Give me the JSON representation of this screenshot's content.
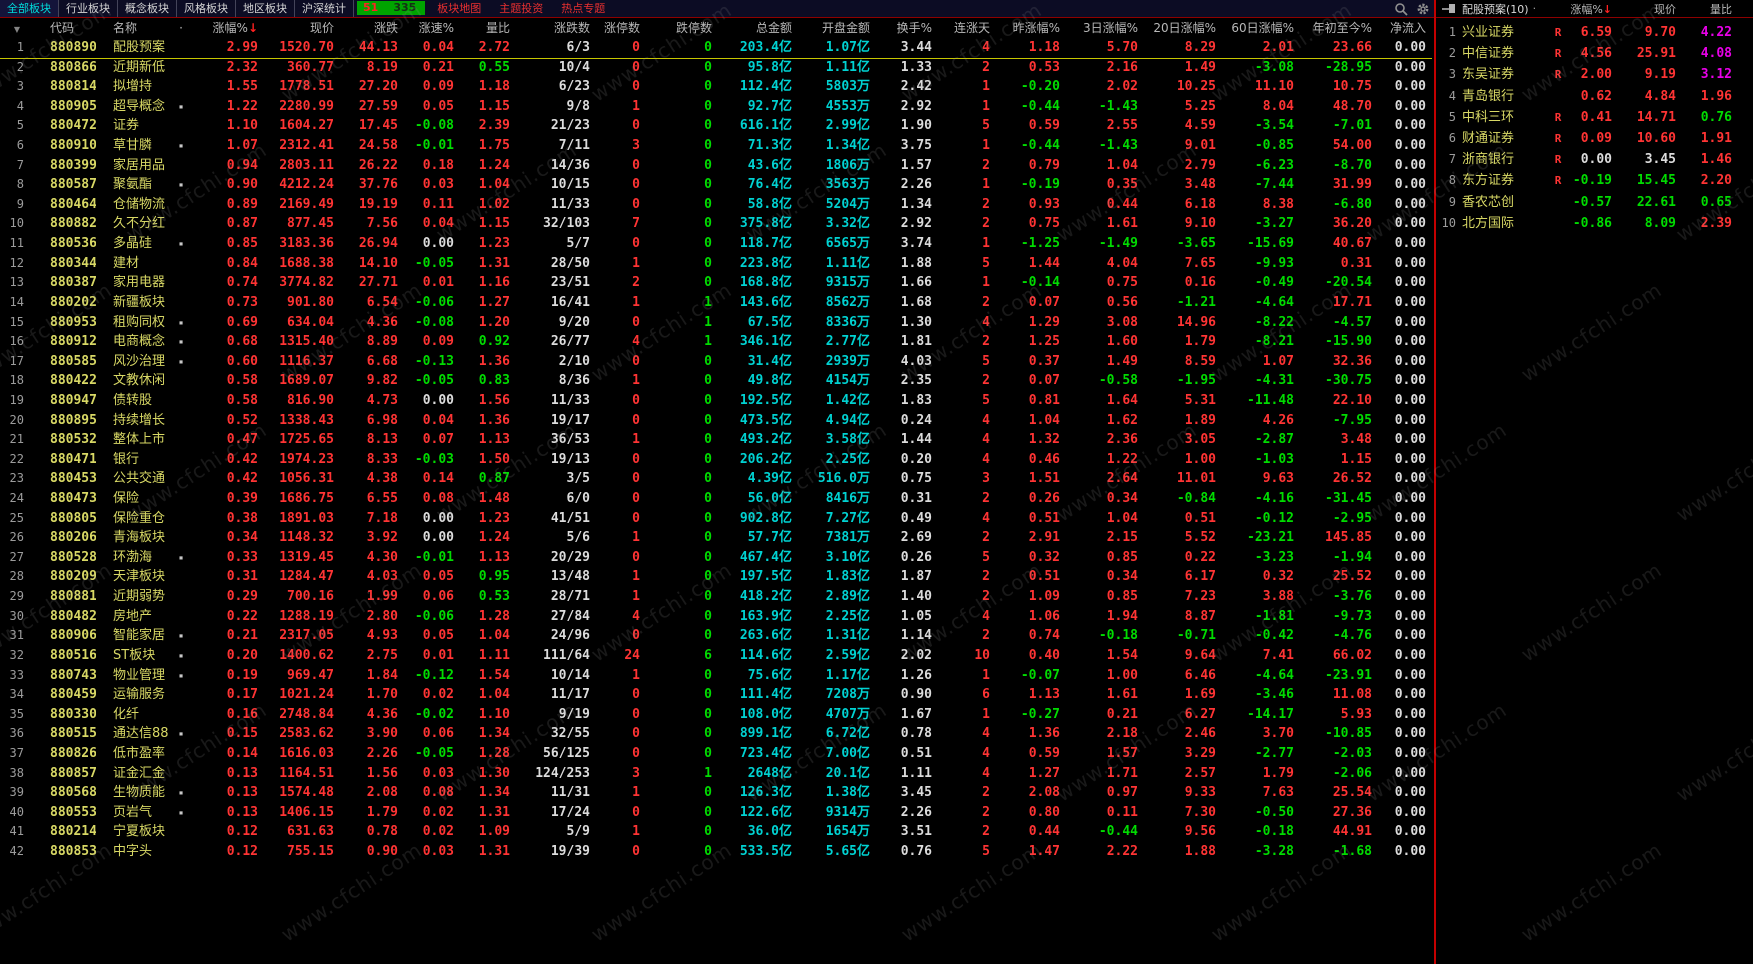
{
  "menu": {
    "tabs": [
      {
        "label": "全部板块"
      },
      {
        "label": "行业板块"
      },
      {
        "label": "概念板块"
      },
      {
        "label": "风格板块"
      },
      {
        "label": "地区板块"
      },
      {
        "label": "沪深统计"
      }
    ],
    "active_tab": "全部板块",
    "badge": {
      "up": "51",
      "down": "335"
    },
    "links": [
      {
        "label": "板块地图"
      },
      {
        "label": "主题投资"
      },
      {
        "label": "热点专题"
      }
    ]
  },
  "table": {
    "headers": [
      "代码",
      "名称",
      "·",
      "涨幅%",
      "现价",
      "涨跌",
      "涨速%",
      "量比",
      "涨跌数",
      "涨停数",
      "跌停数",
      "总金额",
      "开盘金额",
      "换手%",
      "连涨天",
      "昨涨幅%",
      "3日涨幅%",
      "20日涨幅%",
      "60日涨幅%",
      "年初至今%",
      "净流入"
    ],
    "sort_header": "涨幅%",
    "selected_row": 1,
    "rows": [
      [
        1,
        "880890",
        "配股预案",
        false,
        "2.99",
        "1520.70",
        "44.13",
        "0.04",
        "2.72",
        "6/3",
        "0",
        "0",
        "203.4亿",
        "1.07亿",
        "3.44",
        "4",
        "1.18",
        "5.70",
        "8.29",
        "2.01",
        "23.66",
        "0.00"
      ],
      [
        2,
        "880866",
        "近期新低",
        false,
        "2.32",
        "360.77",
        "8.19",
        "0.21",
        "0.55",
        "10/4",
        "0",
        "0",
        "95.8亿",
        "1.11亿",
        "1.33",
        "2",
        "0.53",
        "2.16",
        "1.49",
        "-3.08",
        "-28.95",
        "0.00"
      ],
      [
        3,
        "880814",
        "拟增持",
        false,
        "1.55",
        "1778.51",
        "27.20",
        "0.09",
        "1.18",
        "6/23",
        "0",
        "0",
        "112.4亿",
        "5803万",
        "2.42",
        "1",
        "-0.20",
        "2.02",
        "10.25",
        "11.10",
        "10.75",
        "0.00"
      ],
      [
        4,
        "880905",
        "超导概念",
        true,
        "1.22",
        "2280.99",
        "27.59",
        "0.05",
        "1.15",
        "9/8",
        "1",
        "0",
        "92.7亿",
        "4553万",
        "2.92",
        "1",
        "-0.44",
        "-1.43",
        "5.25",
        "8.04",
        "48.70",
        "0.00"
      ],
      [
        5,
        "880472",
        "证券",
        false,
        "1.10",
        "1604.27",
        "17.45",
        "-0.08",
        "2.39",
        "21/23",
        "0",
        "0",
        "616.1亿",
        "2.99亿",
        "1.90",
        "5",
        "0.59",
        "2.55",
        "4.59",
        "-3.54",
        "-7.01",
        "0.00"
      ],
      [
        6,
        "880910",
        "草甘膦",
        true,
        "1.07",
        "2312.41",
        "24.58",
        "-0.01",
        "1.75",
        "7/11",
        "3",
        "0",
        "71.3亿",
        "1.34亿",
        "3.75",
        "1",
        "-0.44",
        "-1.43",
        "9.01",
        "-0.85",
        "54.00",
        "0.00"
      ],
      [
        7,
        "880399",
        "家居用品",
        false,
        "0.94",
        "2803.11",
        "26.22",
        "0.18",
        "1.24",
        "14/36",
        "0",
        "0",
        "43.6亿",
        "1806万",
        "1.57",
        "2",
        "0.79",
        "1.04",
        "2.79",
        "-6.23",
        "-8.70",
        "0.00"
      ],
      [
        8,
        "880587",
        "聚氨酯",
        true,
        "0.90",
        "4212.24",
        "37.76",
        "0.03",
        "1.04",
        "10/15",
        "0",
        "0",
        "76.4亿",
        "3563万",
        "2.26",
        "1",
        "-0.19",
        "0.35",
        "3.48",
        "-7.44",
        "31.99",
        "0.00"
      ],
      [
        9,
        "880464",
        "仓储物流",
        false,
        "0.89",
        "2169.49",
        "19.19",
        "0.11",
        "1.02",
        "11/33",
        "0",
        "0",
        "58.8亿",
        "5204万",
        "1.34",
        "2",
        "0.93",
        "0.44",
        "6.18",
        "8.38",
        "-6.80",
        "0.00"
      ],
      [
        10,
        "880882",
        "久不分红",
        false,
        "0.87",
        "877.45",
        "7.56",
        "0.04",
        "1.15",
        "32/103",
        "7",
        "0",
        "375.8亿",
        "3.32亿",
        "2.92",
        "2",
        "0.75",
        "1.61",
        "9.10",
        "-3.27",
        "36.20",
        "0.00"
      ],
      [
        11,
        "880536",
        "多晶硅",
        true,
        "0.85",
        "3183.36",
        "26.94",
        "0.00",
        "1.23",
        "5/7",
        "0",
        "0",
        "118.7亿",
        "6565万",
        "3.74",
        "1",
        "-1.25",
        "-1.49",
        "-3.65",
        "-15.69",
        "40.67",
        "0.00"
      ],
      [
        12,
        "880344",
        "建材",
        false,
        "0.84",
        "1688.38",
        "14.10",
        "-0.05",
        "1.31",
        "28/50",
        "1",
        "0",
        "223.8亿",
        "1.11亿",
        "1.88",
        "5",
        "1.44",
        "4.04",
        "7.65",
        "-9.93",
        "0.31",
        "0.00"
      ],
      [
        13,
        "880387",
        "家用电器",
        false,
        "0.74",
        "3774.82",
        "27.71",
        "0.01",
        "1.16",
        "23/51",
        "2",
        "0",
        "168.8亿",
        "9315万",
        "1.66",
        "1",
        "-0.14",
        "0.75",
        "0.16",
        "-0.49",
        "-20.54",
        "0.00"
      ],
      [
        14,
        "880202",
        "新疆板块",
        false,
        "0.73",
        "901.80",
        "6.54",
        "-0.06",
        "1.27",
        "16/41",
        "1",
        "1",
        "143.6亿",
        "8562万",
        "1.68",
        "2",
        "0.07",
        "0.56",
        "-1.21",
        "-4.64",
        "17.71",
        "0.00"
      ],
      [
        15,
        "880953",
        "租购同权",
        true,
        "0.69",
        "634.04",
        "4.36",
        "-0.08",
        "1.20",
        "9/20",
        "0",
        "1",
        "67.5亿",
        "8336万",
        "1.30",
        "4",
        "1.29",
        "3.08",
        "14.96",
        "-8.22",
        "-4.57",
        "0.00"
      ],
      [
        16,
        "880912",
        "电商概念",
        true,
        "0.68",
        "1315.40",
        "8.89",
        "0.09",
        "0.92",
        "26/77",
        "4",
        "1",
        "346.1亿",
        "2.77亿",
        "1.81",
        "2",
        "1.25",
        "1.60",
        "1.79",
        "-8.21",
        "-15.90",
        "0.00"
      ],
      [
        17,
        "880585",
        "风沙治理",
        true,
        "0.60",
        "1116.37",
        "6.68",
        "-0.13",
        "1.36",
        "2/10",
        "0",
        "0",
        "31.4亿",
        "2939万",
        "4.03",
        "5",
        "0.37",
        "1.49",
        "8.59",
        "1.07",
        "32.36",
        "0.00"
      ],
      [
        18,
        "880422",
        "文教休闲",
        false,
        "0.58",
        "1689.07",
        "9.82",
        "-0.05",
        "0.83",
        "8/36",
        "1",
        "0",
        "49.8亿",
        "4154万",
        "2.35",
        "2",
        "0.07",
        "-0.58",
        "-1.95",
        "-4.31",
        "-30.75",
        "0.00"
      ],
      [
        19,
        "880947",
        "债转股",
        false,
        "0.58",
        "816.90",
        "4.73",
        "0.00",
        "1.56",
        "11/33",
        "0",
        "0",
        "192.5亿",
        "1.42亿",
        "1.83",
        "5",
        "0.81",
        "1.64",
        "5.31",
        "-11.48",
        "22.10",
        "0.00"
      ],
      [
        20,
        "880895",
        "持续增长",
        false,
        "0.52",
        "1338.43",
        "6.98",
        "0.04",
        "1.36",
        "19/17",
        "0",
        "0",
        "473.5亿",
        "4.94亿",
        "0.24",
        "4",
        "1.04",
        "1.62",
        "1.89",
        "4.26",
        "-7.95",
        "0.00"
      ],
      [
        21,
        "880532",
        "整体上市",
        false,
        "0.47",
        "1725.65",
        "8.13",
        "0.07",
        "1.13",
        "36/53",
        "1",
        "0",
        "493.2亿",
        "3.58亿",
        "1.44",
        "4",
        "1.32",
        "2.36",
        "3.05",
        "-2.87",
        "3.48",
        "0.00"
      ],
      [
        22,
        "880471",
        "银行",
        false,
        "0.42",
        "1974.23",
        "8.33",
        "-0.03",
        "1.50",
        "19/13",
        "0",
        "0",
        "206.2亿",
        "2.25亿",
        "0.20",
        "4",
        "0.46",
        "1.22",
        "1.00",
        "-1.03",
        "1.15",
        "0.00"
      ],
      [
        23,
        "880453",
        "公共交通",
        false,
        "0.42",
        "1056.31",
        "4.38",
        "0.14",
        "0.87",
        "3/5",
        "0",
        "0",
        "4.39亿",
        "516.0万",
        "0.75",
        "3",
        "1.51",
        "2.64",
        "11.01",
        "9.63",
        "26.52",
        "0.00"
      ],
      [
        24,
        "880473",
        "保险",
        false,
        "0.39",
        "1686.75",
        "6.55",
        "0.08",
        "1.48",
        "6/0",
        "0",
        "0",
        "56.0亿",
        "8416万",
        "0.31",
        "2",
        "0.26",
        "0.34",
        "-0.84",
        "-4.16",
        "-31.45",
        "0.00"
      ],
      [
        25,
        "880805",
        "保险重仓",
        false,
        "0.38",
        "1891.03",
        "7.18",
        "0.00",
        "1.23",
        "41/51",
        "0",
        "0",
        "902.8亿",
        "7.27亿",
        "0.49",
        "4",
        "0.51",
        "1.04",
        "0.51",
        "-0.12",
        "-2.95",
        "0.00"
      ],
      [
        26,
        "880206",
        "青海板块",
        false,
        "0.34",
        "1148.32",
        "3.92",
        "0.00",
        "1.24",
        "5/6",
        "1",
        "0",
        "57.7亿",
        "7381万",
        "2.69",
        "2",
        "2.91",
        "2.15",
        "5.52",
        "-23.21",
        "145.85",
        "0.00"
      ],
      [
        27,
        "880528",
        "环渤海",
        true,
        "0.33",
        "1319.45",
        "4.30",
        "-0.01",
        "1.13",
        "20/29",
        "0",
        "0",
        "467.4亿",
        "3.10亿",
        "0.26",
        "5",
        "0.32",
        "0.85",
        "0.22",
        "-3.23",
        "-1.94",
        "0.00"
      ],
      [
        28,
        "880209",
        "天津板块",
        false,
        "0.31",
        "1284.47",
        "4.03",
        "0.05",
        "0.95",
        "13/48",
        "1",
        "0",
        "197.5亿",
        "1.83亿",
        "1.87",
        "2",
        "0.51",
        "0.34",
        "6.17",
        "0.32",
        "25.52",
        "0.00"
      ],
      [
        29,
        "880881",
        "近期弱势",
        false,
        "0.29",
        "700.16",
        "1.99",
        "0.06",
        "0.53",
        "28/71",
        "1",
        "0",
        "418.2亿",
        "2.89亿",
        "1.40",
        "2",
        "1.09",
        "0.85",
        "7.23",
        "3.88",
        "-3.76",
        "0.00"
      ],
      [
        30,
        "880482",
        "房地产",
        false,
        "0.22",
        "1288.19",
        "2.80",
        "-0.06",
        "1.28",
        "27/84",
        "4",
        "0",
        "163.9亿",
        "2.25亿",
        "1.05",
        "4",
        "1.06",
        "1.94",
        "8.87",
        "-1.81",
        "-9.73",
        "0.00"
      ],
      [
        31,
        "880906",
        "智能家居",
        true,
        "0.21",
        "2317.05",
        "4.93",
        "0.05",
        "1.04",
        "24/96",
        "0",
        "0",
        "263.6亿",
        "1.31亿",
        "1.14",
        "2",
        "0.74",
        "-0.18",
        "-0.71",
        "-0.42",
        "-4.76",
        "0.00"
      ],
      [
        32,
        "880516",
        "ST板块",
        true,
        "0.20",
        "1400.62",
        "2.75",
        "0.01",
        "1.11",
        "111/64",
        "24",
        "6",
        "114.6亿",
        "2.59亿",
        "2.02",
        "10",
        "0.40",
        "1.54",
        "9.64",
        "7.41",
        "66.02",
        "0.00"
      ],
      [
        33,
        "880743",
        "物业管理",
        true,
        "0.19",
        "969.47",
        "1.84",
        "-0.12",
        "1.54",
        "10/14",
        "1",
        "0",
        "75.6亿",
        "1.17亿",
        "1.26",
        "1",
        "-0.07",
        "1.00",
        "6.46",
        "-4.64",
        "-23.91",
        "0.00"
      ],
      [
        34,
        "880459",
        "运输服务",
        false,
        "0.17",
        "1021.24",
        "1.70",
        "0.02",
        "1.04",
        "11/17",
        "0",
        "0",
        "111.4亿",
        "7208万",
        "0.90",
        "6",
        "1.13",
        "1.61",
        "1.69",
        "-3.46",
        "11.08",
        "0.00"
      ],
      [
        35,
        "880330",
        "化纤",
        false,
        "0.16",
        "2748.84",
        "4.36",
        "-0.02",
        "1.10",
        "9/19",
        "0",
        "0",
        "108.0亿",
        "4707万",
        "1.67",
        "1",
        "-0.27",
        "0.21",
        "6.27",
        "-14.17",
        "5.93",
        "0.00"
      ],
      [
        36,
        "880515",
        "通达信88",
        true,
        "0.15",
        "2583.62",
        "3.90",
        "0.06",
        "1.34",
        "32/55",
        "0",
        "0",
        "899.1亿",
        "6.72亿",
        "0.78",
        "4",
        "1.36",
        "2.18",
        "2.46",
        "3.70",
        "-10.85",
        "0.00"
      ],
      [
        37,
        "880826",
        "低市盈率",
        false,
        "0.14",
        "1616.03",
        "2.26",
        "-0.05",
        "1.28",
        "56/125",
        "0",
        "0",
        "723.4亿",
        "7.00亿",
        "0.51",
        "4",
        "0.59",
        "1.57",
        "3.29",
        "-2.77",
        "-2.03",
        "0.00"
      ],
      [
        38,
        "880857",
        "证金汇金",
        false,
        "0.13",
        "1164.51",
        "1.56",
        "0.03",
        "1.30",
        "124/253",
        "3",
        "1",
        "2648亿",
        "20.1亿",
        "1.11",
        "4",
        "1.27",
        "1.71",
        "2.57",
        "1.79",
        "-2.06",
        "0.00"
      ],
      [
        39,
        "880568",
        "生物质能",
        true,
        "0.13",
        "1574.48",
        "2.08",
        "0.08",
        "1.34",
        "11/31",
        "1",
        "0",
        "126.3亿",
        "1.38亿",
        "3.45",
        "2",
        "2.08",
        "0.97",
        "9.33",
        "7.63",
        "25.54",
        "0.00"
      ],
      [
        40,
        "880553",
        "页岩气",
        true,
        "0.13",
        "1406.15",
        "1.79",
        "0.02",
        "1.31",
        "17/24",
        "0",
        "0",
        "122.6亿",
        "9314万",
        "2.26",
        "2",
        "0.80",
        "0.11",
        "7.30",
        "-0.50",
        "27.36",
        "0.00"
      ],
      [
        41,
        "880214",
        "宁夏板块",
        false,
        "0.12",
        "631.63",
        "0.78",
        "0.02",
        "1.09",
        "5/9",
        "1",
        "0",
        "36.0亿",
        "1654万",
        "3.51",
        "2",
        "0.44",
        "-0.44",
        "9.56",
        "-0.18",
        "44.91",
        "0.00"
      ],
      [
        42,
        "880853",
        "中字头",
        false,
        "0.12",
        "755.15",
        "0.90",
        "0.03",
        "1.31",
        "19/39",
        "0",
        "0",
        "533.5亿",
        "5.65亿",
        "0.76",
        "5",
        "1.47",
        "2.22",
        "1.88",
        "-3.28",
        "-1.68",
        "0.00"
      ]
    ]
  },
  "right_panel": {
    "title": "配股预案(10)",
    "headers": [
      "涨幅%",
      "现价",
      "量比"
    ],
    "sort_header": "涨幅%",
    "r_badge": "R",
    "rows": [
      [
        "1",
        "兴业证券",
        true,
        "6.59",
        "9.70",
        "4.22"
      ],
      [
        "2",
        "中信证券",
        true,
        "4.56",
        "25.91",
        "4.08"
      ],
      [
        "3",
        "东吴证券",
        true,
        "2.00",
        "9.19",
        "3.12"
      ],
      [
        "4",
        "青岛银行",
        false,
        "0.62",
        "4.84",
        "1.96"
      ],
      [
        "5",
        "中科三环",
        true,
        "0.41",
        "14.71",
        "0.76"
      ],
      [
        "6",
        "财通证券",
        true,
        "0.09",
        "10.60",
        "1.91"
      ],
      [
        "7",
        "浙商银行",
        true,
        "0.00",
        "3.45",
        "1.46"
      ],
      [
        "8",
        "东方证券",
        true,
        "-0.19",
        "15.45",
        "2.20"
      ],
      [
        "9",
        "香农芯创",
        false,
        "-0.57",
        "22.61",
        "0.65"
      ],
      [
        "10",
        "北方国际",
        false,
        "-0.86",
        "8.09",
        "2.39"
      ]
    ]
  },
  "watermark": {
    "text": "www.cfchi.com"
  },
  "colors": {
    "up": "#ff3434",
    "down": "#00dc00",
    "flat": "#dcdcdc",
    "name_yellow": "#d8d865",
    "amount_cyan": "#00d2d2",
    "index_gray": "#9c9c9c",
    "high_ratio_magenta": "#e800e8",
    "accent_red_line": "#c40000",
    "selection_yellow": "#c6c600"
  }
}
